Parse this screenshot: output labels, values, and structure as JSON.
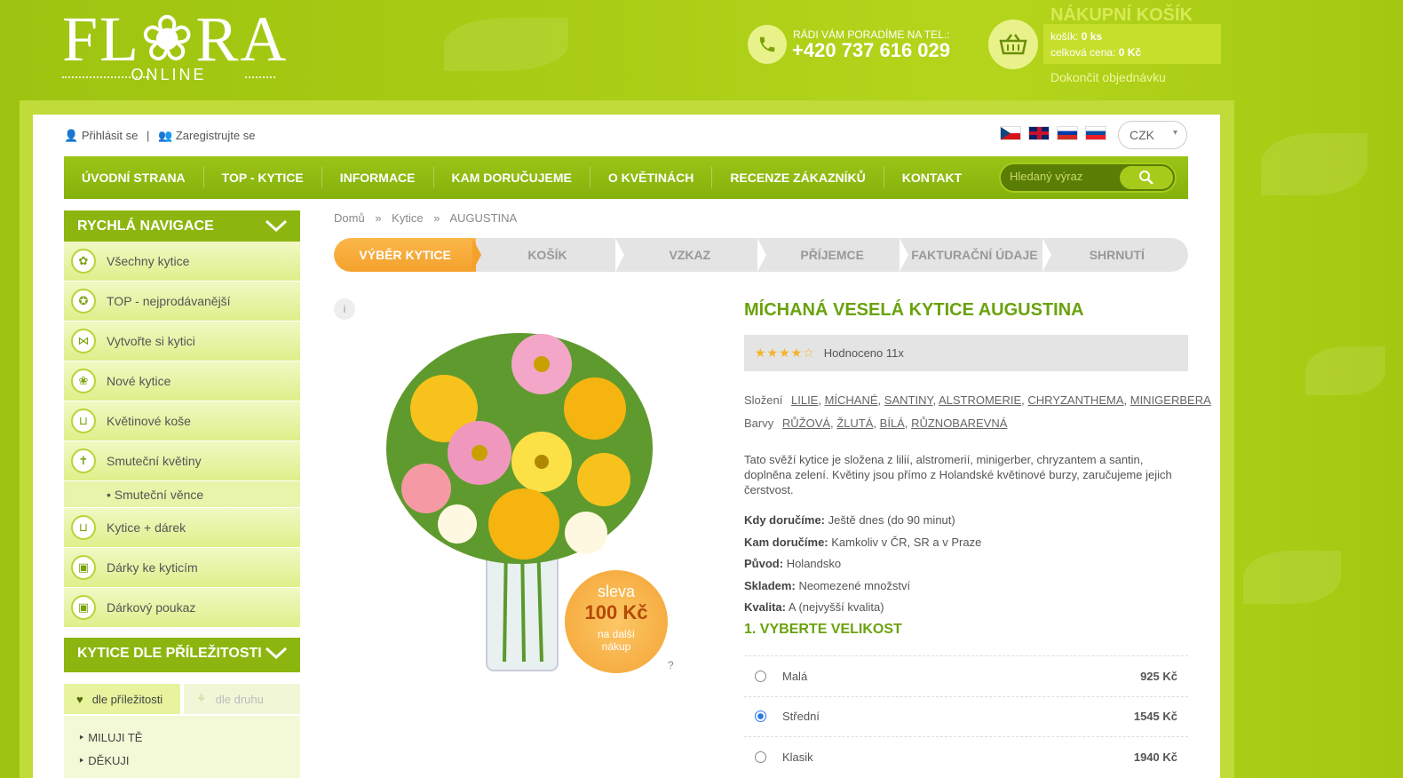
{
  "header": {
    "logo_main": "FL❀RA",
    "logo_sub": "ONLINE",
    "phone_label": "RÁDI VÁM PORADÍME NA TEL.:",
    "phone_number": "+420 737 616 029",
    "cart": {
      "title": "NÁKUPNÍ KOŠÍK",
      "count_label": "košík:",
      "count_value": "0 ks",
      "total_label": "celková cena:",
      "total_value": "0 Kč",
      "finish_link": "Dokončit objednávku"
    }
  },
  "user": {
    "login": "Přihlásit se",
    "separator": "|",
    "register": "Zaregistrujte se"
  },
  "currency": "CZK",
  "nav": {
    "items": [
      "ÚVODNÍ STRANA",
      "TOP - KYTICE",
      "INFORMACE",
      "KAM DORUČUJEME",
      "O KVĚTINÁCH",
      "RECENZE ZÁKAZNÍKŮ",
      "KONTAKT"
    ],
    "search_placeholder": "Hledaný výraz"
  },
  "sidebar": {
    "quick_nav_title": "RYCHLÁ NAVIGACE",
    "items": [
      "Všechny kytice",
      "TOP - nejprodávanější",
      "Vytvořte si kytici",
      "Nové kytice",
      "Květinové koše",
      "Smuteční květiny"
    ],
    "sub_item": "• Smuteční věnce",
    "items2": [
      "Kytice + dárek",
      "Dárky ke kyticím",
      "Dárkový poukaz"
    ],
    "occasion_title": "KYTICE DLE PŘÍLEŽITOSTI",
    "tab_active": "dle příležitosti",
    "tab_inactive": "dle druhu",
    "occasions": [
      "‣ MILUJI TĚ",
      "‣ DĚKUJI"
    ]
  },
  "breadcrumb": {
    "home": "Domů",
    "sep": "»",
    "category": "Kytice",
    "current": "AUGUSTINA"
  },
  "steps": [
    "VÝBĚR KYTICE",
    "KOŠÍK",
    "VZKAZ",
    "PŘÍJEMCE",
    "FAKTURAČNÍ ÚDAJE",
    "SHRNUTÍ"
  ],
  "product": {
    "info_icon": "i",
    "badge_line1": "sleva",
    "badge_line2": "100 Kč",
    "badge_line3": "na další",
    "badge_line4": "nákup",
    "badge_help": "?",
    "title": "MÍCHANÁ VESELÁ KYTICE AUGUSTINA",
    "stars": "★★★★☆",
    "rating_text": "Hodnoceno 11x",
    "composition_label": "Složení",
    "composition": [
      "LILIE",
      "MÍCHANÉ",
      "SANTINY",
      "ALSTROMERIE",
      "CHRYZANTHEMA",
      "MINIGERBERA"
    ],
    "colors_label": "Barvy",
    "colors": [
      "RŮŽOVÁ",
      "ŽLUTÁ",
      "BÍLÁ",
      "RŮZNOBAREVNÁ"
    ],
    "description": "Tato svěží kytice je složena z lilií, alstromerií, minigerber, chryzantem a santin, doplněna zelení. Květiny jsou přímo z Holandské květinové burzy, zaručujeme jejich čerstvost.",
    "facts": [
      {
        "label": "Kdy doručíme:",
        "value": "Ještě dnes (do 90 minut)"
      },
      {
        "label": "Kam doručíme:",
        "value": "Kamkoliv v ČR, SR a v Praze"
      },
      {
        "label": "Původ:",
        "value": "Holandsko"
      },
      {
        "label": "Skladem:",
        "value": "Neomezené množství"
      },
      {
        "label": "Kvalita:",
        "value": "A (nejvyšší kvalita)"
      }
    ],
    "size_title": "1. VYBERTE VELIKOST",
    "sizes": [
      {
        "name": "Malá",
        "price": "925 Kč",
        "selected": false
      },
      {
        "name": "Střední",
        "price": "1545 Kč",
        "selected": true
      },
      {
        "name": "Klasik",
        "price": "1940 Kč",
        "selected": false
      }
    ]
  },
  "colors": {
    "brand_green": "#8cb60f",
    "accent_orange": "#f4a12c",
    "title_green": "#6aa20c"
  }
}
